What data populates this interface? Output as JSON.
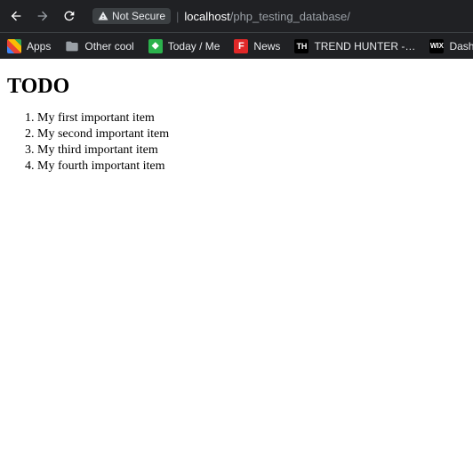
{
  "browser": {
    "security_label": "Not Secure",
    "url_host": "localhost",
    "url_path": "/php_testing_database/"
  },
  "bookmarks": {
    "apps": "Apps",
    "folder": "Other cool",
    "feedly": "Today / Me",
    "flipboard": "News",
    "trendhunter": "TREND HUNTER -…",
    "wix": "Dashboard | Wix.c…"
  },
  "page": {
    "heading": "TODO",
    "items": [
      "My first important item",
      "My second important item",
      "My third important item",
      "My fourth important item"
    ]
  }
}
